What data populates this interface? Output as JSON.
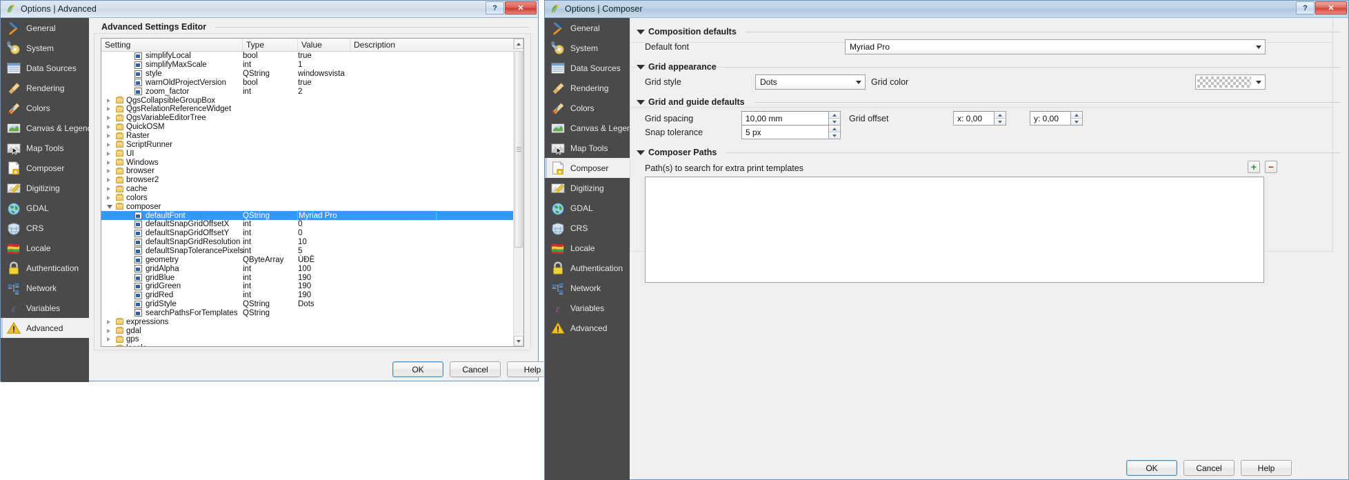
{
  "windows": {
    "left": {
      "title": "Options | Advanced",
      "title_icon": "qgis-logo-icon",
      "buttons": {
        "help": "?",
        "close": "✕"
      },
      "sidebar": [
        {
          "label": "General",
          "icon": "hammer-screwdriver-icon",
          "active": false
        },
        {
          "label": "System",
          "icon": "wrench-gear-icon",
          "active": false
        },
        {
          "label": "Data Sources",
          "icon": "table-grid-icon",
          "active": false
        },
        {
          "label": "Rendering",
          "icon": "brush-icon",
          "active": false
        },
        {
          "label": "Colors",
          "icon": "color-brush-icon",
          "active": false
        },
        {
          "label": "Canvas & Legend",
          "icon": "map-canvas-icon",
          "active": false
        },
        {
          "label": "Map Tools",
          "icon": "map-cursor-icon",
          "active": false
        },
        {
          "label": "Composer",
          "icon": "page-star-icon",
          "active": false
        },
        {
          "label": "Digitizing",
          "icon": "pencil-map-icon",
          "active": false
        },
        {
          "label": "GDAL",
          "icon": "globe-green-icon",
          "active": false
        },
        {
          "label": "CRS",
          "icon": "globe-wire-icon",
          "active": false
        },
        {
          "label": "Locale",
          "icon": "flag-icon",
          "active": false
        },
        {
          "label": "Authentication",
          "icon": "lock-icon",
          "active": false
        },
        {
          "label": "Network",
          "icon": "network-computers-icon",
          "active": false
        },
        {
          "label": "Variables",
          "icon": "epsilon-icon",
          "active": false
        },
        {
          "label": "Advanced",
          "icon": "warning-triangle-icon",
          "active": true
        }
      ],
      "group_title": "Advanced Settings Editor",
      "tree": {
        "columns": [
          "Setting",
          "Type",
          "Value",
          "Description"
        ],
        "rows": [
          {
            "indent": 2,
            "kind": "setting",
            "name": "simplifyLocal",
            "type": "bool",
            "value": "true",
            "desc": "",
            "selected": false
          },
          {
            "indent": 2,
            "kind": "setting",
            "name": "simplifyMaxScale",
            "type": "int",
            "value": "1",
            "desc": "",
            "selected": false
          },
          {
            "indent": 2,
            "kind": "setting",
            "name": "style",
            "type": "QString",
            "value": "windowsvista",
            "desc": "",
            "selected": false
          },
          {
            "indent": 2,
            "kind": "setting",
            "name": "warnOldProjectVersion",
            "type": "bool",
            "value": "true",
            "desc": "",
            "selected": false
          },
          {
            "indent": 2,
            "kind": "setting",
            "name": "zoom_factor",
            "type": "int",
            "value": "2",
            "desc": "",
            "selected": false
          },
          {
            "indent": 1,
            "kind": "folder",
            "expanded": false,
            "name": "QgsCollapsibleGroupBox",
            "type": "",
            "value": "",
            "desc": "",
            "selected": false
          },
          {
            "indent": 1,
            "kind": "folder",
            "expanded": false,
            "name": "QgsRelationReferenceWidget",
            "type": "",
            "value": "",
            "desc": "",
            "selected": false
          },
          {
            "indent": 1,
            "kind": "folder",
            "expanded": false,
            "name": "QgsVariableEditorTree",
            "type": "",
            "value": "",
            "desc": "",
            "selected": false
          },
          {
            "indent": 1,
            "kind": "folder",
            "expanded": false,
            "name": "QuickOSM",
            "type": "",
            "value": "",
            "desc": "",
            "selected": false
          },
          {
            "indent": 1,
            "kind": "folder",
            "expanded": false,
            "name": "Raster",
            "type": "",
            "value": "",
            "desc": "",
            "selected": false
          },
          {
            "indent": 1,
            "kind": "folder",
            "expanded": false,
            "name": "ScriptRunner",
            "type": "",
            "value": "",
            "desc": "",
            "selected": false
          },
          {
            "indent": 1,
            "kind": "folder",
            "expanded": false,
            "name": "UI",
            "type": "",
            "value": "",
            "desc": "",
            "selected": false
          },
          {
            "indent": 1,
            "kind": "folder",
            "expanded": false,
            "name": "Windows",
            "type": "",
            "value": "",
            "desc": "",
            "selected": false
          },
          {
            "indent": 1,
            "kind": "folder",
            "expanded": false,
            "name": "browser",
            "type": "",
            "value": "",
            "desc": "",
            "selected": false
          },
          {
            "indent": 1,
            "kind": "folder",
            "expanded": false,
            "name": "browser2",
            "type": "",
            "value": "",
            "desc": "",
            "selected": false
          },
          {
            "indent": 1,
            "kind": "folder",
            "expanded": false,
            "name": "cache",
            "type": "",
            "value": "",
            "desc": "",
            "selected": false
          },
          {
            "indent": 1,
            "kind": "folder",
            "expanded": false,
            "name": "colors",
            "type": "",
            "value": "",
            "desc": "",
            "selected": false
          },
          {
            "indent": 1,
            "kind": "folder",
            "expanded": true,
            "name": "composer",
            "type": "",
            "value": "",
            "desc": "",
            "selected": false
          },
          {
            "indent": 2,
            "kind": "setting",
            "name": "defaultFont",
            "type": "QString",
            "value": "Myriad Pro",
            "desc": "",
            "selected": true
          },
          {
            "indent": 2,
            "kind": "setting",
            "name": "defaultSnapGridOffsetX",
            "type": "int",
            "value": "0",
            "desc": "",
            "selected": false
          },
          {
            "indent": 2,
            "kind": "setting",
            "name": "defaultSnapGridOffsetY",
            "type": "int",
            "value": "0",
            "desc": "",
            "selected": false
          },
          {
            "indent": 2,
            "kind": "setting",
            "name": "defaultSnapGridResolution",
            "type": "int",
            "value": "10",
            "desc": "",
            "selected": false
          },
          {
            "indent": 2,
            "kind": "setting",
            "name": "defaultSnapTolerancePixels",
            "type": "int",
            "value": "5",
            "desc": "",
            "selected": false
          },
          {
            "indent": 2,
            "kind": "setting",
            "name": "geometry",
            "type": "QByteArray",
            "value": "ÙÐË",
            "desc": "",
            "selected": false
          },
          {
            "indent": 2,
            "kind": "setting",
            "name": "gridAlpha",
            "type": "int",
            "value": "100",
            "desc": "",
            "selected": false
          },
          {
            "indent": 2,
            "kind": "setting",
            "name": "gridBlue",
            "type": "int",
            "value": "190",
            "desc": "",
            "selected": false
          },
          {
            "indent": 2,
            "kind": "setting",
            "name": "gridGreen",
            "type": "int",
            "value": "190",
            "desc": "",
            "selected": false
          },
          {
            "indent": 2,
            "kind": "setting",
            "name": "gridRed",
            "type": "int",
            "value": "190",
            "desc": "",
            "selected": false
          },
          {
            "indent": 2,
            "kind": "setting",
            "name": "gridStyle",
            "type": "QString",
            "value": "Dots",
            "desc": "",
            "selected": false
          },
          {
            "indent": 2,
            "kind": "setting",
            "name": "searchPathsForTemplates",
            "type": "QString",
            "value": "",
            "desc": "",
            "selected": false
          },
          {
            "indent": 1,
            "kind": "folder",
            "expanded": false,
            "name": "expressions",
            "type": "",
            "value": "",
            "desc": "",
            "selected": false
          },
          {
            "indent": 1,
            "kind": "folder",
            "expanded": false,
            "name": "gdal",
            "type": "",
            "value": "",
            "desc": "",
            "selected": false
          },
          {
            "indent": 1,
            "kind": "folder",
            "expanded": false,
            "name": "gps",
            "type": "",
            "value": "",
            "desc": "",
            "selected": false
          },
          {
            "indent": 1,
            "kind": "folder",
            "expanded": false,
            "name": "locale",
            "type": "",
            "value": "",
            "desc": "",
            "selected": false
          }
        ]
      },
      "footer": {
        "ok": "OK",
        "cancel": "Cancel",
        "help": "Help"
      }
    },
    "right": {
      "title": "Options | Composer",
      "title_icon": "qgis-logo-icon",
      "buttons": {
        "help": "?",
        "close": "✕"
      },
      "sidebar": [
        {
          "label": "General",
          "icon": "hammer-screwdriver-icon",
          "active": false
        },
        {
          "label": "System",
          "icon": "wrench-gear-icon",
          "active": false
        },
        {
          "label": "Data Sources",
          "icon": "table-grid-icon",
          "active": false
        },
        {
          "label": "Rendering",
          "icon": "brush-icon",
          "active": false
        },
        {
          "label": "Colors",
          "icon": "color-brush-icon",
          "active": false
        },
        {
          "label": "Canvas & Legend",
          "icon": "map-canvas-icon",
          "active": false
        },
        {
          "label": "Map Tools",
          "icon": "map-cursor-icon",
          "active": false
        },
        {
          "label": "Composer",
          "icon": "page-star-icon",
          "active": true
        },
        {
          "label": "Digitizing",
          "icon": "pencil-map-icon",
          "active": false
        },
        {
          "label": "GDAL",
          "icon": "globe-green-icon",
          "active": false
        },
        {
          "label": "CRS",
          "icon": "globe-wire-icon",
          "active": false
        },
        {
          "label": "Locale",
          "icon": "flag-icon",
          "active": false
        },
        {
          "label": "Authentication",
          "icon": "lock-icon",
          "active": false
        },
        {
          "label": "Network",
          "icon": "network-computers-icon",
          "active": false
        },
        {
          "label": "Variables",
          "icon": "epsilon-icon",
          "active": false
        },
        {
          "label": "Advanced",
          "icon": "warning-triangle-icon",
          "active": false
        }
      ],
      "groups": {
        "composition_defaults": {
          "title": "Composition defaults",
          "default_font_label": "Default font",
          "default_font_value": "Myriad Pro"
        },
        "grid_appearance": {
          "title": "Grid appearance",
          "grid_style_label": "Grid style",
          "grid_style_value": "Dots",
          "grid_color_label": "Grid color",
          "grid_color_value": "transparent-checker"
        },
        "grid_guide_defaults": {
          "title": "Grid and guide defaults",
          "grid_spacing_label": "Grid spacing",
          "grid_spacing_value": "10,00 mm",
          "snap_tolerance_label": "Snap tolerance",
          "snap_tolerance_value": "5 px",
          "grid_offset_label": "Grid offset",
          "offset_x_value": "x: 0,00",
          "offset_y_value": "y: 0,00"
        },
        "composer_paths": {
          "title": "Composer Paths",
          "paths_label": "Path(s) to search for extra print templates",
          "add_button": "+",
          "remove_button": "−",
          "list_value": ""
        }
      },
      "footer": {
        "ok": "OK",
        "cancel": "Cancel",
        "help": "Help"
      }
    }
  },
  "colors": {
    "sidebar_bg": "#4a4a4a",
    "selection_blue": "#3399ff",
    "dialog_bg": "#f0f0f0",
    "titlebar_blue": "#b2c7de",
    "close_red": "#c63b31"
  }
}
